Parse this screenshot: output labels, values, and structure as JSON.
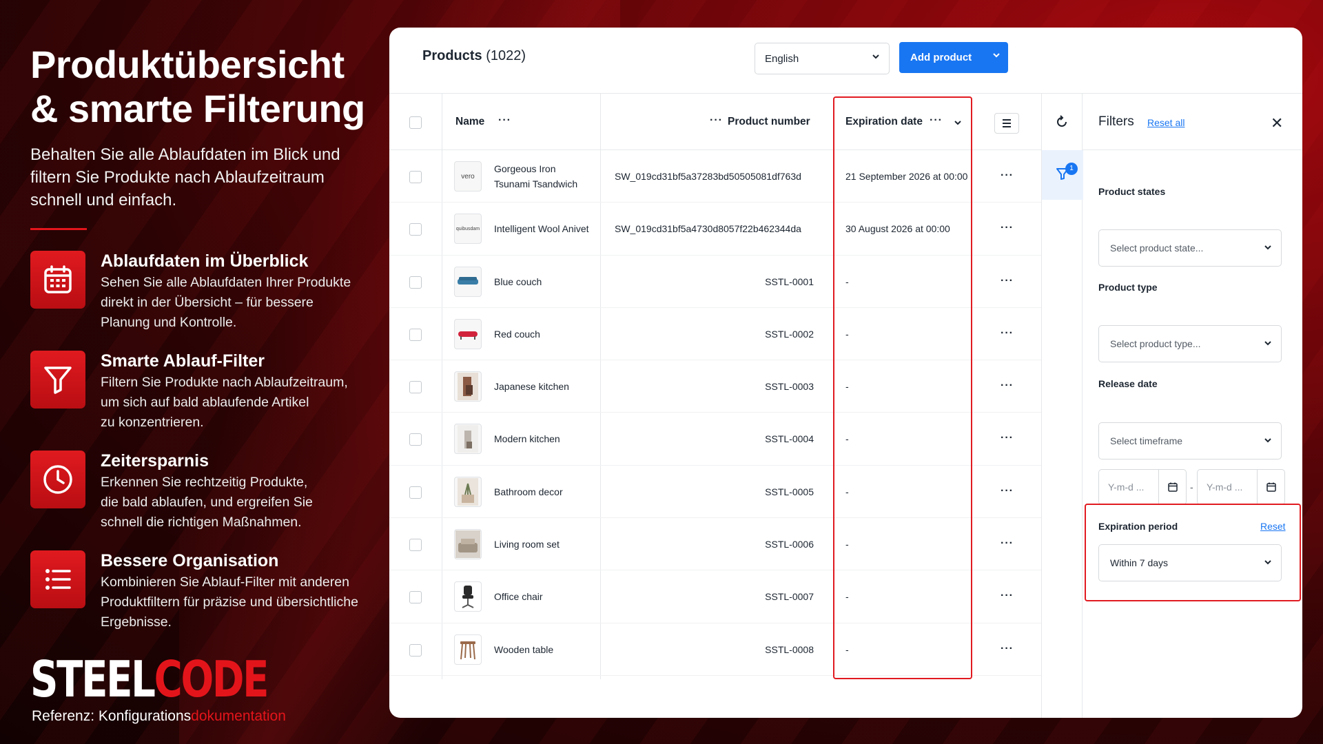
{
  "hero": {
    "title_line1": "Produktübersicht",
    "title_line2": "& smarte Filterung",
    "subtitle": "Behalten Sie alle Ablaufdaten im Blick und filtern Sie Produkte nach Ablaufzeitraum schnell und einfach."
  },
  "features": [
    {
      "icon": "calendar-icon",
      "title": "Ablaufdaten im Überblick",
      "desc": "Sehen Sie alle Ablaufdaten Ihrer Produkte\ndirekt in der Übersicht – für bessere\nPlanung und Kontrolle."
    },
    {
      "icon": "funnel-icon",
      "title": "Smarte Ablauf-Filter",
      "desc": "Filtern Sie Produkte nach Ablaufzeitraum,\num sich auf bald ablaufende Artikel\nzu konzentrieren."
    },
    {
      "icon": "clock-icon",
      "title": "Zeitersparnis",
      "desc": "Erkennen Sie rechtzeitig Produkte,\ndie bald ablaufen, und ergreifen Sie\nschnell die richtigen Maßnahmen."
    },
    {
      "icon": "list-icon",
      "title": "Bessere Organisation",
      "desc": "Kombinieren Sie Ablauf-Filter mit anderen\nProduktfiltern für präzise und übersichtliche\nErgebnisse."
    }
  ],
  "brand": {
    "part1": "STEEL",
    "part2": "CODE"
  },
  "reference": {
    "prefix": "Referenz: Konfigurations",
    "accent": "dokumentation"
  },
  "app": {
    "title": "Products",
    "count": "(1022)",
    "language": "English",
    "add_button": "Add product",
    "columns": {
      "name": "Name",
      "product_number": "Product number",
      "expiration_date": "Expiration date"
    },
    "rows": [
      {
        "thumb": "vero",
        "name": "Gorgeous Iron Tsunami Tsandwich",
        "number": "SW_019cd31bf5a37283bd50505081df763d",
        "expiration": "21 September 2026 at 00:00"
      },
      {
        "thumb": "quibusdam",
        "name": "Intelligent Wool Anivet",
        "number": "SW_019cd31bf5a4730d8057f22b462344da",
        "expiration": "30 August 2026 at 00:00"
      },
      {
        "thumb": "blue-couch-image",
        "name": "Blue couch",
        "number": "SSTL-0001",
        "expiration": "-"
      },
      {
        "thumb": "red-couch-image",
        "name": "Red couch",
        "number": "SSTL-0002",
        "expiration": "-"
      },
      {
        "thumb": "kitchen-image",
        "name": "Japanese kitchen",
        "number": "SSTL-0003",
        "expiration": "-"
      },
      {
        "thumb": "kitchen-image",
        "name": "Modern kitchen",
        "number": "SSTL-0004",
        "expiration": "-"
      },
      {
        "thumb": "decor-image",
        "name": "Bathroom decor",
        "number": "SSTL-0005",
        "expiration": "-"
      },
      {
        "thumb": "living-room-image",
        "name": "Living room set",
        "number": "SSTL-0006",
        "expiration": "-"
      },
      {
        "thumb": "chair-image",
        "name": "Office chair",
        "number": "SSTL-0007",
        "expiration": "-"
      },
      {
        "thumb": "table-image",
        "name": "Wooden table",
        "number": "SSTL-0008",
        "expiration": "-"
      }
    ],
    "filter_badge": "1",
    "filters": {
      "title": "Filters",
      "reset_all": "Reset all",
      "product_states_label": "Product states",
      "product_states_placeholder": "Select product state...",
      "product_type_label": "Product type",
      "product_type_placeholder": "Select product type...",
      "release_date_label": "Release date",
      "release_date_placeholder": "Select timeframe",
      "date_from_placeholder": "Y-m-d ...",
      "date_to_placeholder": "Y-m-d ...",
      "expiration_period_label": "Expiration period",
      "expiration_reset": "Reset",
      "expiration_period_value": "Within 7 days"
    }
  },
  "colors": {
    "accent_red": "#e3151b",
    "primary_blue": "#1976f2"
  }
}
